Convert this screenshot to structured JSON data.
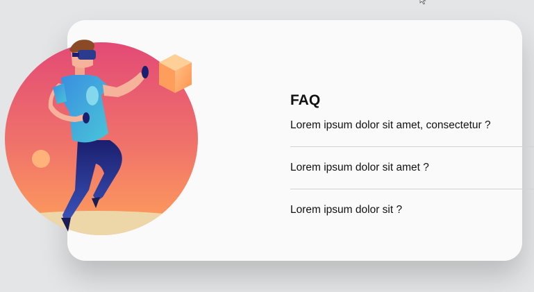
{
  "faq": {
    "title": "FAQ",
    "items": [
      {
        "question": "Lorem ipsum dolor sit amet, consectetur ?",
        "icon": "chevron-down-icon"
      },
      {
        "question": "Lorem ipsum dolor sit amet ?",
        "icon": "chevron-down-icon"
      },
      {
        "question": "Lorem ipsum dolor sit ?",
        "icon": "chevron-down-icon"
      }
    ]
  },
  "colors": {
    "background": "#e4e5e6",
    "card": "#fafafa",
    "circle_top": "#e34a75",
    "circle_bottom": "#ffa15a",
    "chevron": "#a7afae"
  }
}
